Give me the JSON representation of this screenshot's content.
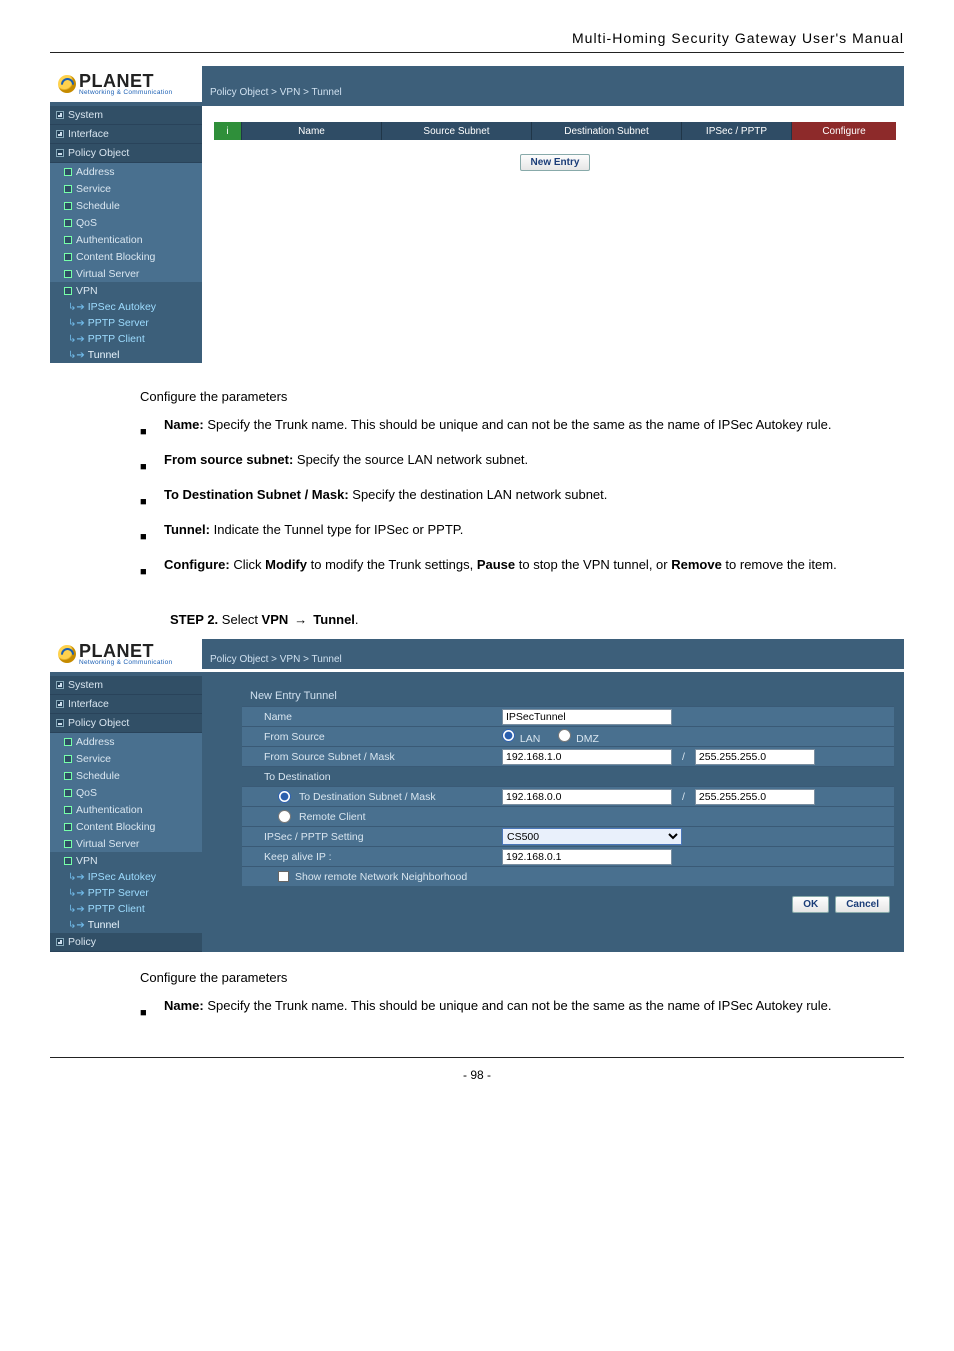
{
  "header": {
    "manual_title": "Multi-Homing  Security  Gateway  User's  Manual"
  },
  "logo": {
    "brand": "PLANET",
    "tagline": "Networking & Communication"
  },
  "breadcrumb": "Policy Object > VPN > Tunnel",
  "sidebar1": {
    "system": "System",
    "interface": "Interface",
    "policy_object": "Policy Object",
    "address": "Address",
    "service": "Service",
    "schedule": "Schedule",
    "qos": "QoS",
    "authentication": "Authentication",
    "content_blocking": "Content Blocking",
    "virtual_server": "Virtual Server",
    "vpn": "VPN",
    "ipsec_autokey": "IPSec Autokey",
    "pptp_server": "PPTP Server",
    "pptp_client": "PPTP Client",
    "tunnel": "Tunnel"
  },
  "table1": {
    "i": "i",
    "name": "Name",
    "source": "Source Subnet",
    "dest": "Destination Subnet",
    "ipsec_pptp": "IPSec / PPTP",
    "configure": "Configure",
    "new_entry": "New Entry"
  },
  "instr1": {
    "configure": "Configure the parameters",
    "b1_label": "Name:",
    "b1_text": " Specify the Trunk name. This should be unique and can not be the same as the name of IPSec Autokey rule.",
    "b2_label": "From source subnet:",
    "b2_text": " Specify the source LAN network subnet.",
    "b3_label": "To Destination Subnet / Mask:",
    "b3_text": " Specify the destination LAN network subnet.",
    "b4_label": "Tunnel:",
    "b4_text": " Indicate the Tunnel type for IPSec or PPTP.",
    "b5_label": "Configure:",
    "b5_click": " Click ",
    "b5_modify": "Modify",
    "b5_mid1": " to modify the Trunk settings, ",
    "b5_pause": "Pause",
    "b5_mid2": " to stop the VPN tunnel, or ",
    "b5_remove": "Remove",
    "b5_end": " to remove the item."
  },
  "step2": {
    "line_prefix": "STEP 2.",
    "select": " Select ",
    "vpn": "VPN",
    "tunnel": "Tunnel"
  },
  "form": {
    "title": "New Entry Tunnel",
    "row_name": "Name",
    "row_from_source": "From Source",
    "row_from_mask": "From Source Subnet / Mask",
    "row_to_dest": "To Destination",
    "row_to_mask": "To Destination Subnet / Mask",
    "row_remote_client": "Remote Client",
    "row_ipsec_pptp": "IPSec / PPTP Setting",
    "row_keepalive": "Keep alive IP :",
    "row_show_nn": "Show remote Network Neighborhood",
    "val_name": "IPSecTunnel",
    "radio_lan": "LAN",
    "radio_dmz": "DMZ",
    "src_ip": "192.168.1.0",
    "src_mask": "255.255.255.0",
    "dst_ip": "192.168.0.0",
    "dst_mask": "255.255.255.0",
    "sel_opt": "CS500",
    "keepalive_ip": "192.168.0.1",
    "ok": "OK",
    "cancel": "Cancel"
  },
  "sidebar2_extra": {
    "policy": "Policy"
  },
  "instr2": {
    "configure": "Configure the parameters",
    "b1_text": " Specify the Trunk name. This should be unique and can not be the same as the name of IPSec Autokey rule."
  },
  "page_number": "- 98 -"
}
